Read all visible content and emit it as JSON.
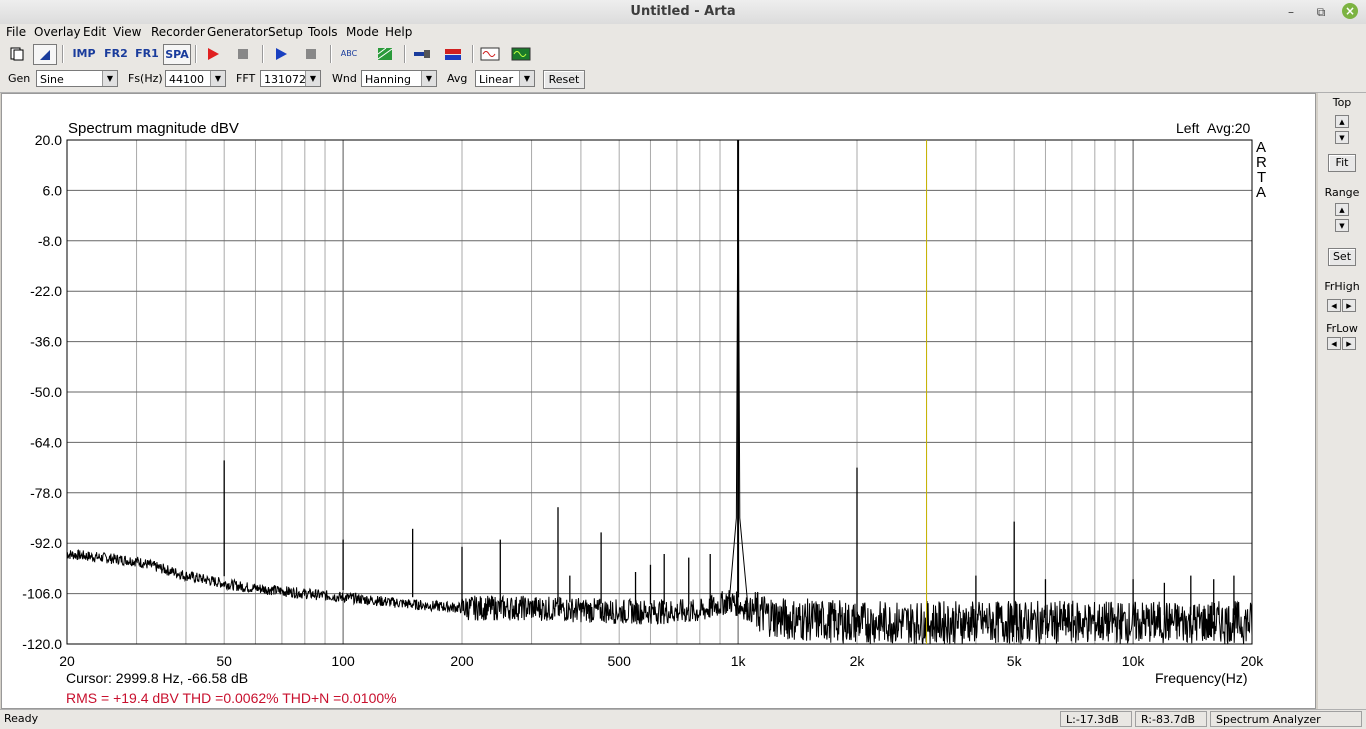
{
  "window": {
    "title": "Untitled - Arta"
  },
  "menu": [
    "File",
    "Overlay",
    "Edit",
    "View",
    "Recorder",
    "Generator",
    "Setup",
    "Tools",
    "Mode",
    "Help"
  ],
  "toolbar": {
    "imp_label": "IMP",
    "fr2_label": "FR2",
    "fr1_label": "FR1",
    "spa_label": "SPA",
    "abc_label": "ABC"
  },
  "controls": {
    "gen_label": "Gen",
    "gen_value": "Sine",
    "fs_label": "Fs(Hz)",
    "fs_value": "44100",
    "fft_label": "FFT",
    "fft_value": "131072",
    "wnd_label": "Wnd",
    "wnd_value": "Hanning",
    "avg_label": "Avg",
    "avg_value": "Linear",
    "reset_label": "Reset"
  },
  "side": {
    "top_label": "Top",
    "fit_label": "Fit",
    "range_label": "Range",
    "set_label": "Set",
    "frhigh_label": "FrHigh",
    "frlow_label": "FrLow"
  },
  "plot": {
    "title": "Spectrum magnitude dBV",
    "channel": "Left",
    "avg": "Avg:20",
    "watermark": [
      "A",
      "R",
      "T",
      "A"
    ],
    "cursor_text": "Cursor:  2999.8 Hz, -66.58 dB",
    "stats_text": "RMS =  +19.4 dBV   THD =0.0062%   THD+N =0.0100%"
  },
  "status": {
    "ready": "Ready",
    "left_level": "L:-17.3dB",
    "right_level": "R:-83.7dB",
    "mode": "Spectrum Analyzer"
  },
  "chart_data": {
    "type": "line",
    "title": "Spectrum magnitude dBV",
    "xlabel": "Frequency(Hz)",
    "ylabel": "",
    "x_scale": "log",
    "xlim": [
      20,
      20000
    ],
    "ylim": [
      -120,
      20
    ],
    "x_tick_labels": [
      "20",
      "50",
      "100",
      "200",
      "500",
      "1k",
      "2k",
      "5k",
      "10k",
      "20k"
    ],
    "x_tick_values": [
      20,
      50,
      100,
      200,
      500,
      1000,
      2000,
      5000,
      10000,
      20000
    ],
    "y_ticks": [
      20.0,
      6.0,
      -8.0,
      -22.0,
      -36.0,
      -50.0,
      -64.0,
      -78.0,
      -92.0,
      -106.0,
      -120.0
    ],
    "y_tick_labels": [
      "20.0",
      "6.0",
      "-8.0",
      "-22.0",
      "-36.0",
      "-50.0",
      "-64.0",
      "-78.0",
      "-92.0",
      "-106.0",
      "-120.0"
    ],
    "grid": true,
    "cursor_freq": 2999.8,
    "cursor_level": -66.58,
    "noise_floor": [
      [
        20,
        -95
      ],
      [
        30,
        -97
      ],
      [
        40,
        -101
      ],
      [
        49,
        -103
      ],
      [
        55,
        -104
      ],
      [
        80,
        -106
      ],
      [
        100,
        -107
      ],
      [
        150,
        -109
      ],
      [
        200,
        -110
      ],
      [
        300,
        -110
      ],
      [
        500,
        -111
      ],
      [
        800,
        -111
      ],
      [
        950,
        -108
      ],
      [
        1100,
        -111
      ],
      [
        1300,
        -113
      ],
      [
        2000,
        -114
      ],
      [
        5000,
        -114
      ],
      [
        10000,
        -114
      ],
      [
        20000,
        -114
      ]
    ],
    "peaks": [
      {
        "x": 50,
        "y": -69
      },
      {
        "x": 100,
        "y": -91
      },
      {
        "x": 150,
        "y": -88
      },
      {
        "x": 200,
        "y": -93
      },
      {
        "x": 250,
        "y": -91
      },
      {
        "x": 350,
        "y": -82
      },
      {
        "x": 375,
        "y": -101
      },
      {
        "x": 450,
        "y": -89
      },
      {
        "x": 550,
        "y": -100
      },
      {
        "x": 600,
        "y": -98
      },
      {
        "x": 650,
        "y": -95
      },
      {
        "x": 750,
        "y": -96
      },
      {
        "x": 850,
        "y": -95
      },
      {
        "x": 1000,
        "y": 20
      },
      {
        "x": 2000,
        "y": -71
      },
      {
        "x": 4000,
        "y": -101
      },
      {
        "x": 5000,
        "y": -86
      },
      {
        "x": 6000,
        "y": -102
      },
      {
        "x": 10000,
        "y": -102
      },
      {
        "x": 12000,
        "y": -103
      },
      {
        "x": 14000,
        "y": -101
      },
      {
        "x": 16000,
        "y": -102
      },
      {
        "x": 18000,
        "y": -101
      }
    ]
  }
}
